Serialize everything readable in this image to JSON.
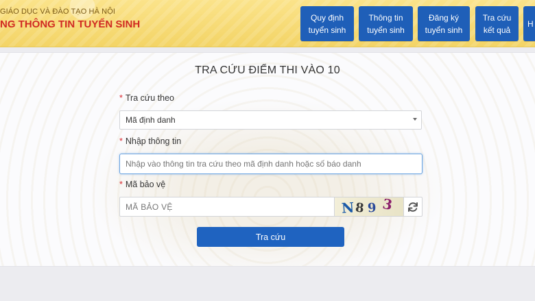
{
  "header": {
    "org_line": "GIÁO DỤC VÀ ĐÀO TẠO HÀ NỘI",
    "portal_title": "NG THÔNG TIN TUYỂN SINH",
    "nav": [
      {
        "label": "Quy định tuyển sinh"
      },
      {
        "label": "Thông tin tuyển sinh"
      },
      {
        "label": "Đăng ký tuyển sinh"
      },
      {
        "label": "Tra cứu kết quả"
      },
      {
        "label": "H"
      }
    ]
  },
  "form": {
    "heading": "TRA CỨU ĐIỂM THI VÀO 10",
    "lookup_by": {
      "required_mark": "*",
      "label": "Tra cứu theo",
      "selected": "Mã định danh"
    },
    "info": {
      "required_mark": "*",
      "label": "Nhập thông tin",
      "placeholder": "Nhập vào thông tin tra cứu theo mã định danh hoặc số báo danh"
    },
    "captcha": {
      "required_mark": "*",
      "label": "Mã bảo vệ",
      "placeholder": "MÃ BẢO VỆ",
      "chars": [
        "N",
        "8",
        "9",
        "3"
      ],
      "colors": [
        "#1a5aa8",
        "#3a3a3a",
        "#2a4a9a",
        "#8a1f6a"
      ]
    },
    "submit_label": "Tra cứu"
  },
  "colors": {
    "header_bg": "#f8dc7a",
    "title_red": "#d02a22",
    "nav_blue": "#1f5fb8",
    "button_blue": "#1f63c0",
    "required_red": "#d9262c"
  }
}
